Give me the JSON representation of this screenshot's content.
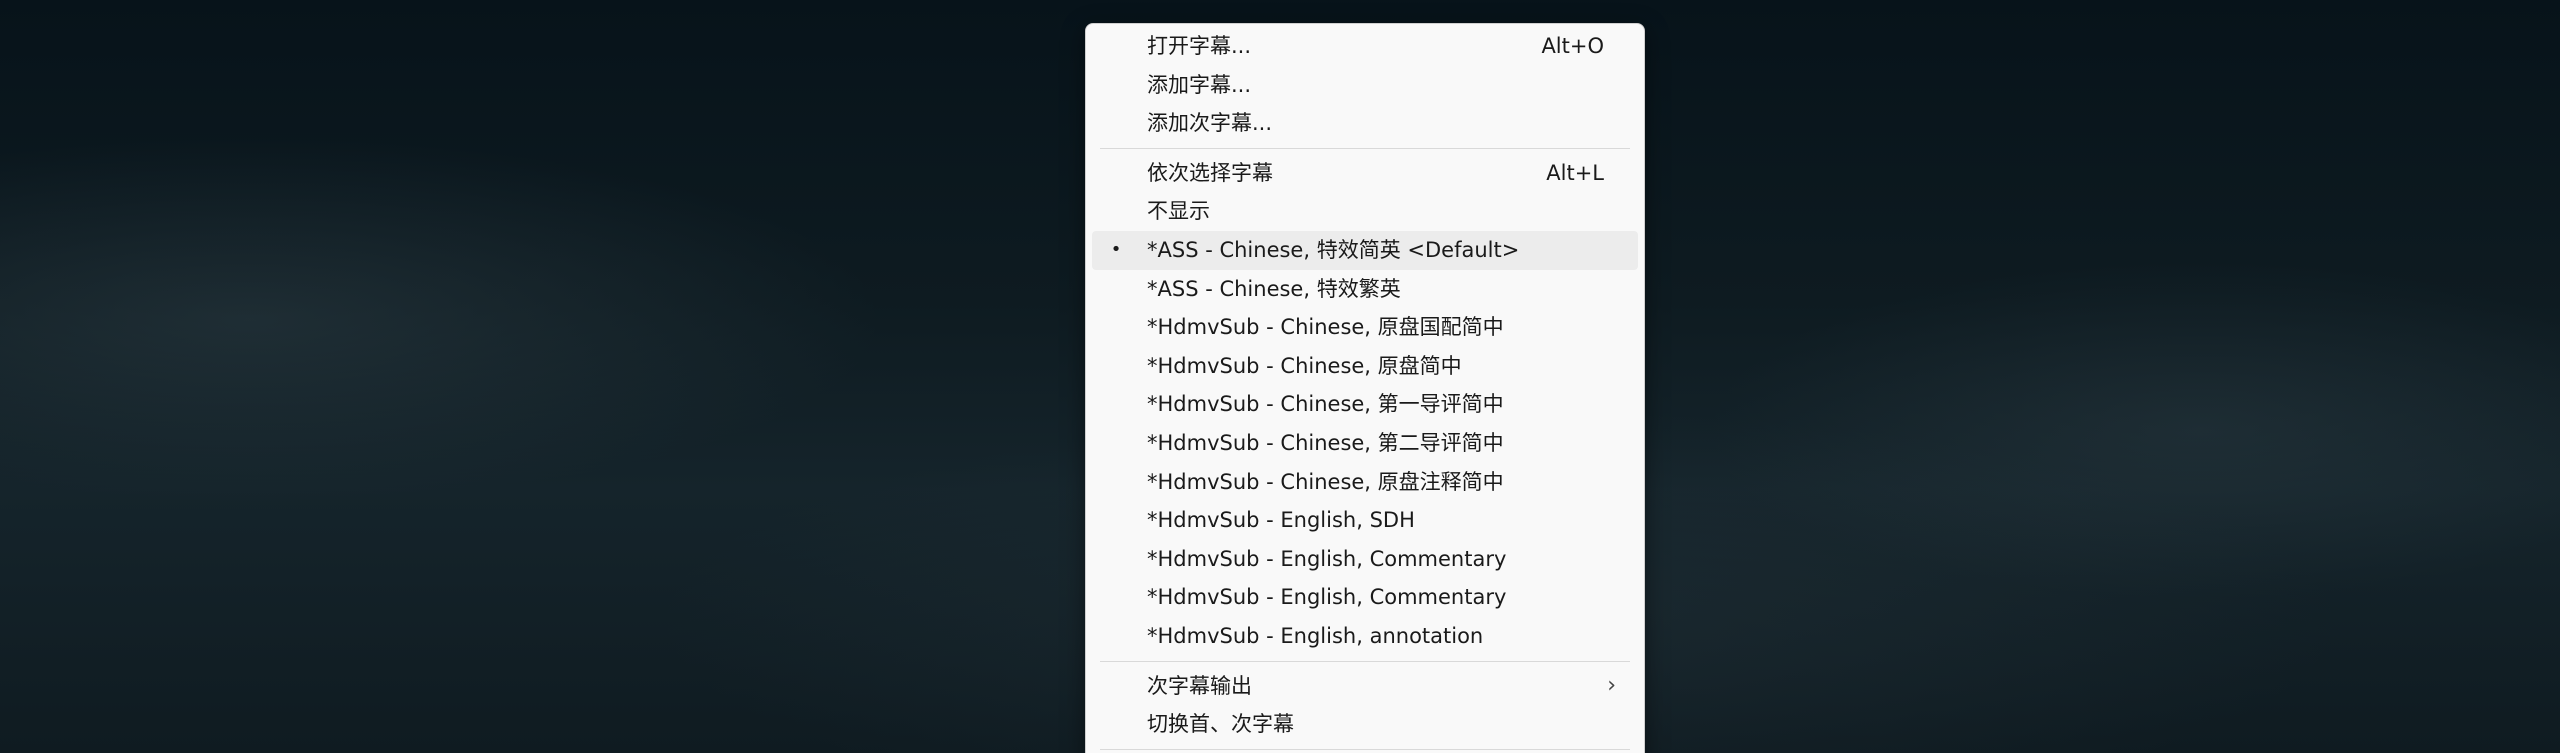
{
  "menu": {
    "group1": [
      {
        "label": "打开字幕...",
        "shortcut": "Alt+O"
      },
      {
        "label": "添加字幕...",
        "shortcut": ""
      },
      {
        "label": "添加次字幕...",
        "shortcut": ""
      }
    ],
    "group2": [
      {
        "label": "依次选择字幕",
        "shortcut": "Alt+L",
        "selected": false
      },
      {
        "label": "不显示",
        "shortcut": "",
        "selected": false
      },
      {
        "label": "*ASS - Chinese, 特效简英 <Default>",
        "shortcut": "",
        "selected": true
      },
      {
        "label": "*ASS - Chinese, 特效繁英",
        "shortcut": "",
        "selected": false
      },
      {
        "label": "*HdmvSub - Chinese, 原盘国配简中",
        "shortcut": "",
        "selected": false
      },
      {
        "label": "*HdmvSub - Chinese, 原盘简中",
        "shortcut": "",
        "selected": false
      },
      {
        "label": "*HdmvSub - Chinese, 第一导评简中",
        "shortcut": "",
        "selected": false
      },
      {
        "label": "*HdmvSub - Chinese, 第二导评简中",
        "shortcut": "",
        "selected": false
      },
      {
        "label": "*HdmvSub - Chinese, 原盘注释简中",
        "shortcut": "",
        "selected": false
      },
      {
        "label": "*HdmvSub - English, SDH",
        "shortcut": "",
        "selected": false
      },
      {
        "label": "*HdmvSub - English, Commentary",
        "shortcut": "",
        "selected": false
      },
      {
        "label": "*HdmvSub - English, Commentary",
        "shortcut": "",
        "selected": false
      },
      {
        "label": "*HdmvSub - English, annotation",
        "shortcut": "",
        "selected": false
      }
    ],
    "group3": [
      {
        "label": "次字幕输出",
        "has_submenu": true
      },
      {
        "label": "切换首、次字幕",
        "has_submenu": false
      }
    ],
    "bullet_glyph": "•",
    "chevron_glyph": "›",
    "colors": {
      "menu_bg": "#f9f9f9",
      "hover_bg": "#ececec",
      "text": "#1a1a1a"
    }
  }
}
